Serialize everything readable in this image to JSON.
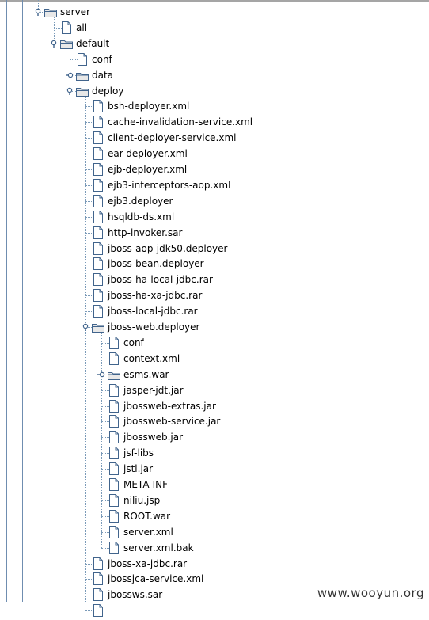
{
  "tree": {
    "rows": [
      {
        "label": "server",
        "icon": "folder-open-icon",
        "level": 0,
        "expand": "expanded"
      },
      {
        "label": "all",
        "icon": "file-icon",
        "level": 1,
        "expand": "none"
      },
      {
        "label": "default",
        "icon": "folder-open-icon",
        "level": 1,
        "expand": "expanded"
      },
      {
        "label": "conf",
        "icon": "file-icon",
        "level": 2,
        "expand": "none"
      },
      {
        "label": "data",
        "icon": "folder-closed-icon",
        "level": 2,
        "expand": "collapsed"
      },
      {
        "label": "deploy",
        "icon": "folder-open-icon",
        "level": 2,
        "expand": "expanded"
      },
      {
        "label": "bsh-deployer.xml",
        "icon": "file-icon",
        "level": 3,
        "expand": "none"
      },
      {
        "label": "cache-invalidation-service.xml",
        "icon": "file-icon",
        "level": 3,
        "expand": "none"
      },
      {
        "label": "client-deployer-service.xml",
        "icon": "file-icon",
        "level": 3,
        "expand": "none"
      },
      {
        "label": "ear-deployer.xml",
        "icon": "file-icon",
        "level": 3,
        "expand": "none"
      },
      {
        "label": "ejb-deployer.xml",
        "icon": "file-icon",
        "level": 3,
        "expand": "none"
      },
      {
        "label": "ejb3-interceptors-aop.xml",
        "icon": "file-icon",
        "level": 3,
        "expand": "none"
      },
      {
        "label": "ejb3.deployer",
        "icon": "file-icon",
        "level": 3,
        "expand": "none"
      },
      {
        "label": "hsqldb-ds.xml",
        "icon": "file-icon",
        "level": 3,
        "expand": "none"
      },
      {
        "label": "http-invoker.sar",
        "icon": "file-icon",
        "level": 3,
        "expand": "none"
      },
      {
        "label": "jboss-aop-jdk50.deployer",
        "icon": "file-icon",
        "level": 3,
        "expand": "none"
      },
      {
        "label": "jboss-bean.deployer",
        "icon": "file-icon",
        "level": 3,
        "expand": "none"
      },
      {
        "label": "jboss-ha-local-jdbc.rar",
        "icon": "file-icon",
        "level": 3,
        "expand": "none"
      },
      {
        "label": "jboss-ha-xa-jdbc.rar",
        "icon": "file-icon",
        "level": 3,
        "expand": "none"
      },
      {
        "label": "jboss-local-jdbc.rar",
        "icon": "file-icon",
        "level": 3,
        "expand": "none"
      },
      {
        "label": "jboss-web.deployer",
        "icon": "folder-open-icon",
        "level": 3,
        "expand": "expanded"
      },
      {
        "label": "conf",
        "icon": "file-icon",
        "level": 4,
        "expand": "none"
      },
      {
        "label": "context.xml",
        "icon": "file-icon",
        "level": 4,
        "expand": "none"
      },
      {
        "label": "esms.war",
        "icon": "folder-closed-icon",
        "level": 4,
        "expand": "collapsed"
      },
      {
        "label": "jasper-jdt.jar",
        "icon": "file-icon",
        "level": 4,
        "expand": "none"
      },
      {
        "label": "jbossweb-extras.jar",
        "icon": "file-icon",
        "level": 4,
        "expand": "none"
      },
      {
        "label": "jbossweb-service.jar",
        "icon": "file-icon",
        "level": 4,
        "expand": "none"
      },
      {
        "label": "jbossweb.jar",
        "icon": "file-icon",
        "level": 4,
        "expand": "none"
      },
      {
        "label": "jsf-libs",
        "icon": "file-icon",
        "level": 4,
        "expand": "none"
      },
      {
        "label": "jstl.jar",
        "icon": "file-icon",
        "level": 4,
        "expand": "none"
      },
      {
        "label": "META-INF",
        "icon": "file-icon",
        "level": 4,
        "expand": "none"
      },
      {
        "label": "niliu.jsp",
        "icon": "file-icon",
        "level": 4,
        "expand": "none"
      },
      {
        "label": "ROOT.war",
        "icon": "file-icon",
        "level": 4,
        "expand": "none"
      },
      {
        "label": "server.xml",
        "icon": "file-icon",
        "level": 4,
        "expand": "none"
      },
      {
        "label": "server.xml.bak",
        "icon": "file-icon",
        "level": 4,
        "expand": "none"
      },
      {
        "label": "jboss-xa-jdbc.rar",
        "icon": "file-icon",
        "level": 3,
        "expand": "none"
      },
      {
        "label": "jbossjca-service.xml",
        "icon": "file-icon",
        "level": 3,
        "expand": "none"
      },
      {
        "label": "jbossws.sar",
        "icon": "file-icon",
        "level": 3,
        "expand": "none"
      },
      {
        "label": "",
        "icon": "file-icon",
        "level": 3,
        "expand": "none"
      }
    ]
  },
  "watermark": "www.wooyun.org",
  "colors": {
    "tree_line": "#7a9ab8",
    "icon_stroke": "#41648c",
    "folder_fill": "#e8e8e8",
    "handle": "#41648c"
  }
}
